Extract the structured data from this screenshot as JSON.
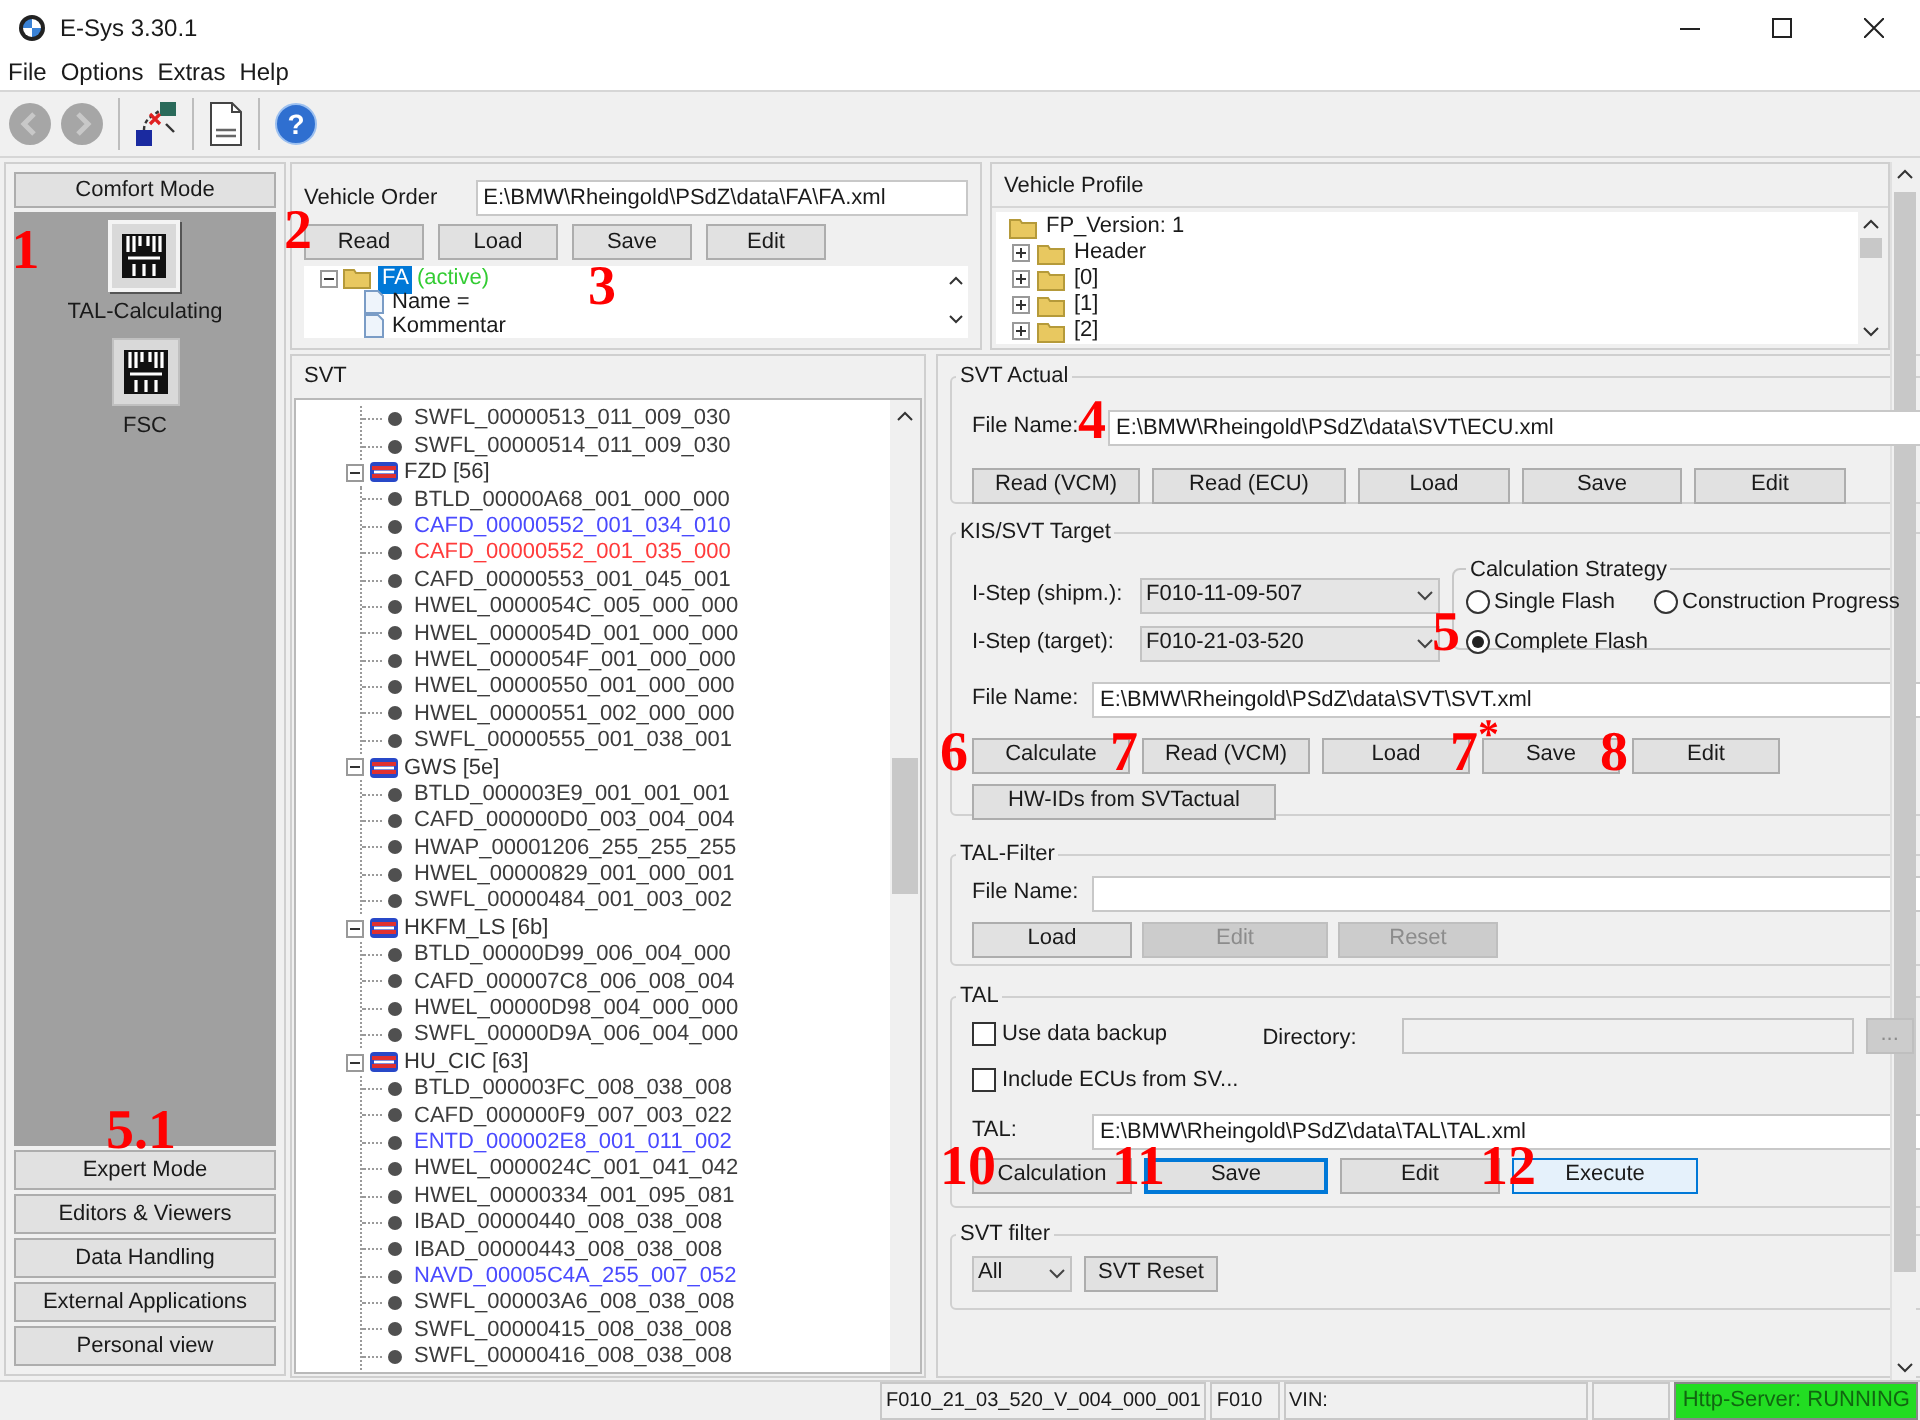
{
  "window": {
    "title": "E-Sys 3.30.1"
  },
  "menu": [
    "File",
    "Options",
    "Extras",
    "Help"
  ],
  "toolbar": [
    {
      "kind": "back",
      "disabled": true
    },
    {
      "kind": "forward",
      "disabled": true
    },
    {
      "kind": "connect"
    },
    {
      "kind": "log"
    },
    {
      "kind": "help",
      "glyph": "?"
    }
  ],
  "left_panel": {
    "header": "Comfort Mode",
    "tiles": [
      {
        "label": "TAL-Calculating",
        "selected": true,
        "marker": "1"
      },
      {
        "label": "FSC",
        "selected": false
      }
    ],
    "buttons": [
      {
        "label": "Expert Mode",
        "marker": "5.1"
      },
      {
        "label": "Editors & Viewers"
      },
      {
        "label": "Data Handling"
      },
      {
        "label": "External Applications"
      },
      {
        "label": "Personal view"
      }
    ]
  },
  "vehicle_order": {
    "label": "Vehicle Order",
    "file": "E:\\BMW\\Rheingold\\PSdZ\\data\\FA\\FA.xml",
    "buttons": [
      {
        "label": "Read",
        "marker": "2"
      },
      {
        "label": "Load"
      },
      {
        "label": "Save",
        "marker": "3"
      },
      {
        "label": "Edit"
      }
    ],
    "tree": {
      "label": "FA",
      "selected": true,
      "status": "(active)",
      "children": [
        {
          "label": "Name ="
        },
        {
          "label": "Kommentar"
        }
      ]
    }
  },
  "vehicle_profile": {
    "title": "Vehicle Profile",
    "tree": {
      "label": "FP_Version: 1",
      "children": [
        {
          "label": "Header"
        },
        {
          "label": "[0]"
        },
        {
          "label": "[1]"
        },
        {
          "label": "[2]"
        }
      ]
    }
  },
  "svt": {
    "title": "SVT",
    "tree": [
      {
        "children": [
          {
            "label": "SWFL_00000513_011_009_030",
            "color": "#3c3c3c"
          },
          {
            "label": "SWFL_00000514_011_009_030",
            "color": "#3c3c3c"
          }
        ]
      },
      {
        "label": "FZD [56]",
        "children": [
          {
            "label": "BTLD_00000A68_001_000_000",
            "color": "#3c3c3c"
          },
          {
            "label": "CAFD_00000552_001_034_010",
            "color": "#4a4aff"
          },
          {
            "label": "CAFD_00000552_001_035_000",
            "color": "#ff3b3b"
          },
          {
            "label": "CAFD_00000553_001_045_001",
            "color": "#3c3c3c"
          },
          {
            "label": "HWEL_0000054C_005_000_000",
            "color": "#3c3c3c"
          },
          {
            "label": "HWEL_0000054D_001_000_000",
            "color": "#3c3c3c"
          },
          {
            "label": "HWEL_0000054F_001_000_000",
            "color": "#3c3c3c"
          },
          {
            "label": "HWEL_00000550_001_000_000",
            "color": "#3c3c3c"
          },
          {
            "label": "HWEL_00000551_002_000_000",
            "color": "#3c3c3c"
          },
          {
            "label": "SWFL_00000555_001_038_001",
            "color": "#3c3c3c"
          }
        ]
      },
      {
        "label": "GWS [5e]",
        "children": [
          {
            "label": "BTLD_000003E9_001_001_001",
            "color": "#3c3c3c"
          },
          {
            "label": "CAFD_000000D0_003_004_004",
            "color": "#3c3c3c"
          },
          {
            "label": "HWAP_00001206_255_255_255",
            "color": "#3c3c3c"
          },
          {
            "label": "HWEL_00000829_001_000_001",
            "color": "#3c3c3c"
          },
          {
            "label": "SWFL_00000484_001_003_002",
            "color": "#3c3c3c"
          }
        ]
      },
      {
        "label": "HKFM_LS [6b]",
        "children": [
          {
            "label": "BTLD_00000D99_006_004_000",
            "color": "#3c3c3c"
          },
          {
            "label": "CAFD_000007C8_006_008_004",
            "color": "#3c3c3c"
          },
          {
            "label": "HWEL_00000D98_004_000_000",
            "color": "#3c3c3c"
          },
          {
            "label": "SWFL_00000D9A_006_004_000",
            "color": "#3c3c3c"
          }
        ]
      },
      {
        "label": "HU_CIC [63]",
        "children": [
          {
            "label": "BTLD_000003FC_008_038_008",
            "color": "#3c3c3c"
          },
          {
            "label": "CAFD_000000F9_007_003_022",
            "color": "#3c3c3c"
          },
          {
            "label": "ENTD_000002E8_001_011_002",
            "color": "#4a4aff"
          },
          {
            "label": "HWEL_0000024C_001_041_042",
            "color": "#3c3c3c"
          },
          {
            "label": "HWEL_00000334_001_095_081",
            "color": "#3c3c3c"
          },
          {
            "label": "IBAD_00000440_008_038_008",
            "color": "#3c3c3c"
          },
          {
            "label": "IBAD_00000443_008_038_008",
            "color": "#3c3c3c"
          },
          {
            "label": "NAVD_00005C4A_255_007_052",
            "color": "#4a4aff"
          },
          {
            "label": "SWFL_000003A6_008_038_008",
            "color": "#3c3c3c"
          },
          {
            "label": "SWFL_00000415_008_038_008",
            "color": "#3c3c3c"
          },
          {
            "label": "SWFL_00000416_008_038_008",
            "color": "#3c3c3c"
          }
        ]
      }
    ]
  },
  "svt_actual": {
    "title": "SVT Actual",
    "file_label": "File Name:",
    "file_marker": "4",
    "file": "E:\\BMW\\Rheingold\\PSdZ\\data\\SVT\\ECU.xml",
    "buttons": [
      {
        "label": "Read (VCM)"
      },
      {
        "label": "Read (ECU)"
      },
      {
        "label": "Load"
      },
      {
        "label": "Save"
      },
      {
        "label": "Edit"
      }
    ]
  },
  "kis_svt_target": {
    "title": "KIS/SVT Target",
    "selects": [
      {
        "label": "I-Step (shipm.):",
        "value": "F010-11-09-507"
      },
      {
        "label": "I-Step (target):",
        "value": "F010-21-03-520"
      }
    ],
    "strategy": {
      "title": "Calculation Strategy",
      "options": [
        {
          "label": "Single Flash",
          "selected": false
        },
        {
          "label": "Construction Progress",
          "selected": false
        },
        {
          "label": "Complete Flash",
          "selected": true,
          "marker": "5"
        }
      ]
    },
    "file_label": "File Name:",
    "file": "E:\\BMW\\Rheingold\\PSdZ\\data\\SVT\\SVT.xml",
    "buttons": [
      {
        "label": "Calculate",
        "marker": "6"
      },
      {
        "label": "Read (VCM)",
        "marker": "7"
      },
      {
        "label": "Load"
      },
      {
        "label": "Save",
        "marker": "7$^{*}$"
      },
      {
        "label": "Edit",
        "marker": "8"
      }
    ],
    "extra_button": {
      "label": "HW-IDs from SVTactual"
    }
  },
  "tal_filter": {
    "title": "TAL-Filter",
    "file_label": "File Name:",
    "buttons": [
      {
        "label": "Load",
        "disabled": false
      },
      {
        "label": "Edit",
        "disabled": true
      },
      {
        "label": "Reset",
        "disabled": true
      }
    ]
  },
  "tal": {
    "title": "TAL",
    "checkboxes": [
      {
        "label": "Use data backup",
        "checked": false
      },
      {
        "label": "Include ECUs from SV...",
        "checked": false
      }
    ],
    "directory_label": "Directory:",
    "browse": {
      "label": "...",
      "disabled": true
    },
    "file_label": "TAL:",
    "file": "E:\\BMW\\Rheingold\\PSdZ\\data\\TAL\\TAL.xml",
    "buttons": [
      {
        "label": "Calculation",
        "focused": false,
        "highlighted": false,
        "marker": "10"
      },
      {
        "label": "Save",
        "focused": true,
        "highlighted": false,
        "marker": "11"
      },
      {
        "label": "Edit",
        "focused": false,
        "highlighted": false
      },
      {
        "label": "Execute",
        "focused": false,
        "highlighted": true,
        "marker": "12"
      }
    ]
  },
  "svt_filter": {
    "title": "SVT filter",
    "select": "All",
    "button": {
      "label": "SVT Reset"
    }
  },
  "status_bar": {
    "fields": [
      "F010_21_03_520_V_004_000_001",
      "F010",
      "VIN:"
    ],
    "server": "Http-Server: RUNNING"
  }
}
